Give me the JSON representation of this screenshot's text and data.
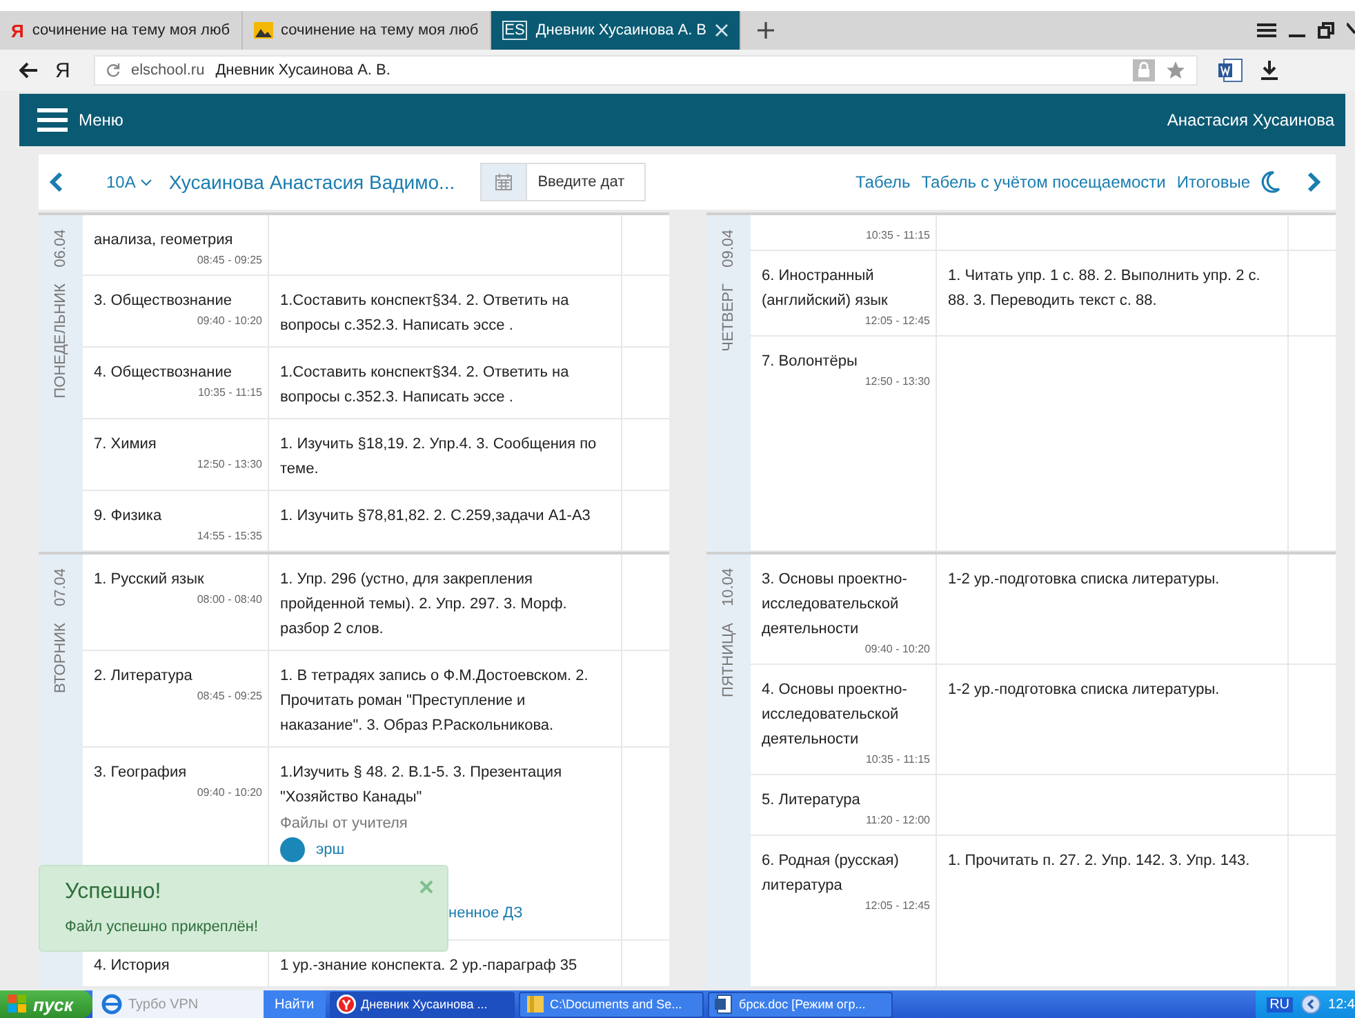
{
  "browser": {
    "tabs": [
      {
        "kind": "yandex",
        "favicon": "Я",
        "title": "сочинение на тему моя люб",
        "selected": false
      },
      {
        "kind": "image",
        "title": "сочинение на тему моя люб",
        "selected": false
      },
      {
        "kind": "site",
        "favicon": "ES",
        "title": "Дневник Хусаинова А. В",
        "selected": true
      }
    ],
    "address": {
      "logo": "Я",
      "domain": "elschool.ru",
      "page_title": "Дневник Хусаинова А. В."
    }
  },
  "header": {
    "menu_label": "Меню",
    "user_name": "Анастасия Хусаинова"
  },
  "toolbar": {
    "class_label": "10А",
    "student": "Хусаинова Анастасия Вадимо...",
    "date_placeholder": "Введите дат",
    "links": [
      "Табель",
      "Табель с учётом посещаемости",
      "Итоговые"
    ]
  },
  "diary": {
    "columns": [
      {
        "days": [
          {
            "name": "ПОНЕДЕЛЬНИК",
            "date": "06.04",
            "lessons": [
              {
                "title": "анализа, геометрия",
                "time": "08:45 - 09:25"
              },
              {
                "title": "3. Обществознание",
                "time": "09:40 - 10:20",
                "homework": "1.Составить конспект§34. 2. Ответить на вопросы с.352.3. Написать эссе ."
              },
              {
                "title": "4. Обществознание",
                "time": "10:35 - 11:15",
                "homework": "1.Составить конспект§34. 2. Ответить на вопросы с.352.3. Написать эссе ."
              },
              {
                "title": "7. Химия",
                "time": "12:50 - 13:30",
                "homework": "1. Изучить §18,19. 2. Упр.4. 3. Сообщения по теме."
              },
              {
                "title": "9. Физика",
                "time": "14:55 - 15:35",
                "homework": "1. Изучить §78,81,82. 2. С.259,задачи А1-А3"
              }
            ]
          },
          {
            "name": "ВТОРНИК",
            "date": "07.04",
            "lessons": [
              {
                "title": "1. Русский язык",
                "time": "08:00 - 08:40",
                "homework": "1. Упр. 296 (устно, для закрепления пройденной темы). 2. Упр. 297. 3. Морф. разбор 2 слов."
              },
              {
                "title": "2. Литература",
                "time": "08:45 - 09:25",
                "homework": "1. В тетрадях запись о Ф.М.Достоевском. 2. Прочитать роман \"Преступление и наказание\". 3. Образ Р.Раскольникова."
              },
              {
                "title": "3. География",
                "time": "09:40 - 10:20",
                "homework": "1.Изучить § 48. 2. В.1-5. 3. Презентация \"Хозяйство Канады\"",
                "files_heading": "Файлы от учителя",
                "files": [
                  "эрш"
                ],
                "attachment_link": "ненное ДЗ"
              },
              {
                "title": "4. История",
                "homework": "1 ур.-знание конспекта. 2 ур.-параграф 35"
              }
            ]
          }
        ]
      },
      {
        "days": [
          {
            "name": "ЧЕТВЕРГ",
            "date": "09.04",
            "lessons": [
              {
                "time": "10:35 - 11:15"
              },
              {
                "title": "6. Иностранный (английский) язык",
                "time": "12:05 - 12:45",
                "homework": "1. Читать упр. 1 с. 88. 2. Выполнить упр. 2 с. 88. 3. Переводить текст с. 88."
              },
              {
                "title": "7. Волонтёры",
                "time": "12:50 - 13:30"
              }
            ]
          },
          {
            "name": "ПЯТНИЦА",
            "date": "10.04",
            "lessons": [
              {
                "title": "3. Основы проектно-исследовательской деятельности",
                "time": "09:40 - 10:20",
                "homework": "1-2 ур.-подготовка списка литературы."
              },
              {
                "title": "4. Основы проектно-исследовательской деятельности",
                "time": "10:35 - 11:15",
                "homework": "1-2 ур.-подготовка списка литературы."
              },
              {
                "title": "5. Литература",
                "time": "11:20 - 12:00"
              },
              {
                "title": "6. Родная (русская) литература",
                "time": "12:05 - 12:45",
                "homework": "1. Прочитать п. 27. 2. Упр. 142. 3. Упр. 143."
              }
            ]
          }
        ]
      }
    ]
  },
  "toast": {
    "title": "Успешно!",
    "message": "Файл успешно прикреплён!"
  },
  "taskbar": {
    "start": "пуск",
    "quick_launch": "Турбо VPN",
    "search": "Найти",
    "windows": [
      {
        "kind": "browser",
        "title": "Дневник Хусаинова ...",
        "selected": true
      },
      {
        "kind": "folder",
        "title": "C:\\Documents and Se...",
        "selected": false
      },
      {
        "kind": "document",
        "title": "брск.doc [Режим огр...",
        "selected": false
      }
    ],
    "language": "RU",
    "clock": "12:4"
  }
}
